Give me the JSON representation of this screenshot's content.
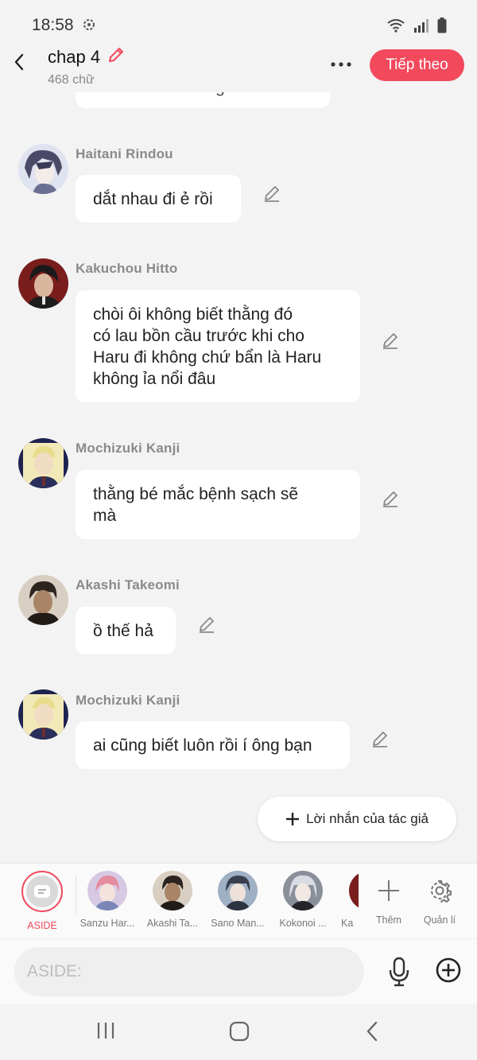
{
  "status_bar": {
    "time": "18:58"
  },
  "header": {
    "title": "chap 4",
    "word_count": "468 chữ",
    "next_label": "Tiếp theo"
  },
  "colors": {
    "accent": "#f2495d",
    "background": "#f3f3f3",
    "bubble": "#ffffff"
  },
  "chat": {
    "partial_text": "đái Haru và thằng Ran đâu",
    "messages": [
      {
        "name": "Haitani Rindou",
        "text": "dắt nhau đi ẻ rồi"
      },
      {
        "name": "Kakuchou Hitto",
        "text": "chòi ôi không biết thằng đó\ncó lau bồn cầu trước khi cho\nHaru đi không chứ bẩn là Haru\nkhông ỉa nổi đâu"
      },
      {
        "name": "Mochizuki Kanji",
        "text": "thằng bé mắc bệnh sạch sẽ\nmà"
      },
      {
        "name": "Akashi Takeomi",
        "text": "ồ thế hả"
      },
      {
        "name": "Mochizuki Kanji",
        "text": "ai cũng biết luôn rồi í ông bạn"
      }
    ]
  },
  "author_note_label": "Lời nhắn của tác giả",
  "characters": {
    "aside": "ASIDE",
    "items": [
      "Sanzu Har...",
      "Akashi Ta...",
      "Sano Man...",
      "Kokonoi ...",
      "Ka"
    ],
    "add_label": "Thêm",
    "manage_label": "Quản lí"
  },
  "input": {
    "placeholder": "ASIDE:"
  }
}
